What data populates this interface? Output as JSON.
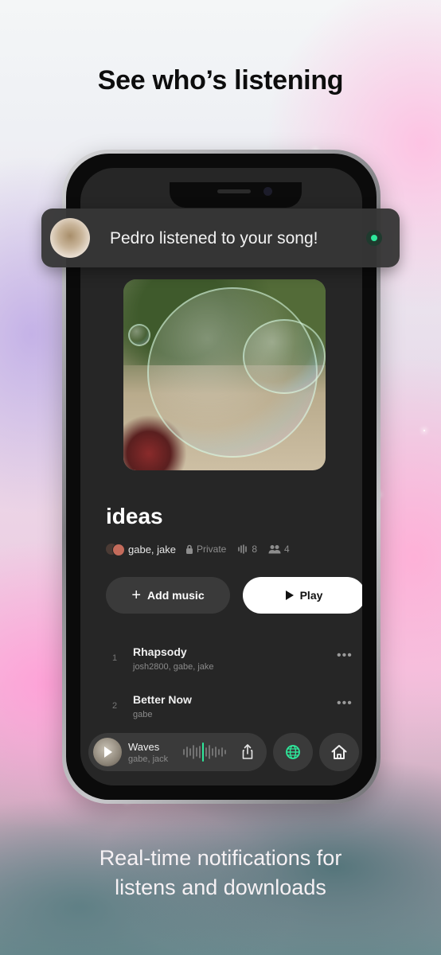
{
  "headline": "See who’s listening",
  "notification": {
    "text": "Pedro listened to your song!",
    "status_color": "#2ee89b"
  },
  "playlist": {
    "title": "ideas",
    "members": "gabe, jake",
    "privacy": "Private",
    "listens": "8",
    "collaborators": "4"
  },
  "actions": {
    "add_music": "Add music",
    "play": "Play"
  },
  "tracks": [
    {
      "number": "1",
      "name": "Rhapsody",
      "artists": "josh2800, gabe, jake"
    },
    {
      "number": "2",
      "name": "Better Now",
      "artists": "gabe"
    }
  ],
  "now_playing": {
    "title": "Waves",
    "artists": "gabe, jack",
    "accent_color": "#2ee89b"
  },
  "caption": {
    "line1": "Real-time notifications for",
    "line2": "listens and downloads"
  }
}
